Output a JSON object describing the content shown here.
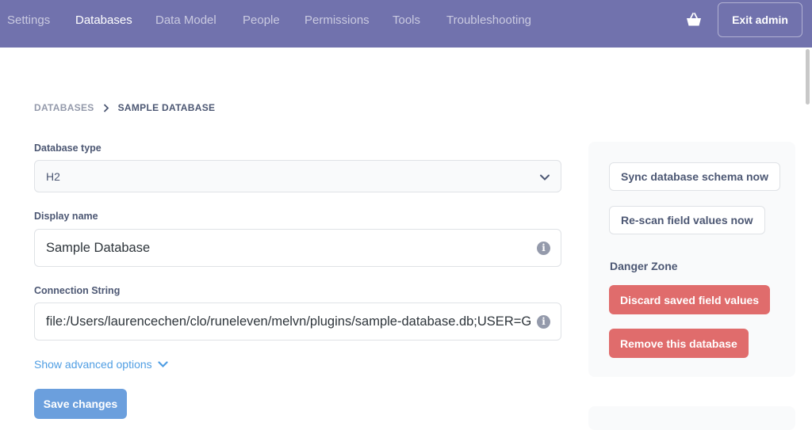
{
  "nav": {
    "items": [
      {
        "label": "Settings",
        "active": false
      },
      {
        "label": "Databases",
        "active": true
      },
      {
        "label": "Data Model",
        "active": false
      },
      {
        "label": "People",
        "active": false
      },
      {
        "label": "Permissions",
        "active": false
      },
      {
        "label": "Tools",
        "active": false
      },
      {
        "label": "Troubleshooting",
        "active": false
      }
    ],
    "cart_icon": "shopping-basket-icon",
    "exit_label": "Exit admin"
  },
  "breadcrumb": {
    "parent": "DATABASES",
    "current": "SAMPLE DATABASE"
  },
  "form": {
    "database_type_label": "Database type",
    "database_type_value": "H2",
    "display_name_label": "Display name",
    "display_name_value": "Sample Database",
    "connection_string_label": "Connection String",
    "connection_string_value": "file:/Users/laurencechen/clo/runeleven/melvn/plugins/sample-database.db;USER=GUEST;PASSWORD=guest",
    "advanced_label": "Show advanced options",
    "save_label": "Save changes"
  },
  "side": {
    "sync_label": "Sync database schema now",
    "rescan_label": "Re-scan field values now",
    "danger_title": "Danger Zone",
    "discard_label": "Discard saved field values",
    "remove_label": "Remove this database"
  },
  "colors": {
    "nav_bg": "#7172ad",
    "brand_blue": "#509ee3",
    "danger": "#e06c6c"
  }
}
